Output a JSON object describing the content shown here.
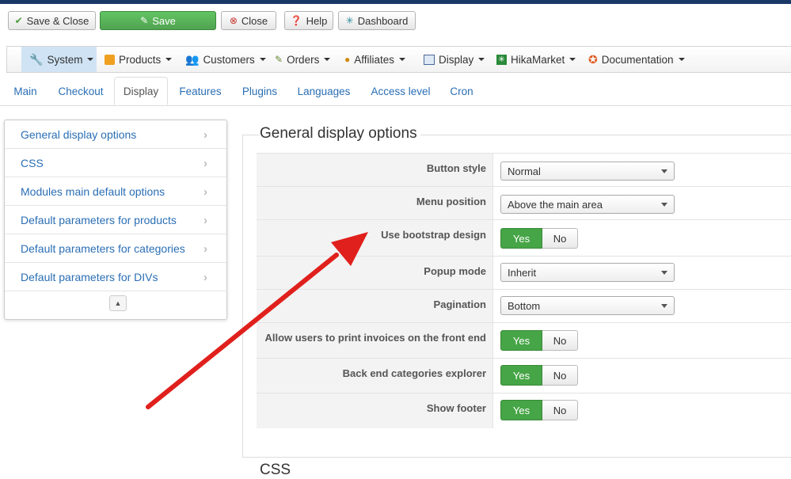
{
  "toolbar": {
    "save_close": "Save & Close",
    "save": "Save",
    "close": "Close",
    "help": "Help",
    "dashboard": "Dashboard"
  },
  "menu": [
    {
      "label": "System",
      "icon": "wrench-icon"
    },
    {
      "label": "Products",
      "icon": "box-icon"
    },
    {
      "label": "Customers",
      "icon": "users-icon"
    },
    {
      "label": "Orders",
      "icon": "orders-icon"
    },
    {
      "label": "Affiliates",
      "icon": "affiliates-icon"
    },
    {
      "label": "Display",
      "icon": "display-icon"
    },
    {
      "label": "HikaMarket",
      "icon": "hikamarket-icon"
    },
    {
      "label": "Documentation",
      "icon": "lifebuoy-icon"
    }
  ],
  "tabs": [
    "Main",
    "Checkout",
    "Display",
    "Features",
    "Plugins",
    "Languages",
    "Access level",
    "Cron"
  ],
  "active_tab": "Display",
  "sidebar": {
    "items": [
      "General display options",
      "CSS",
      "Modules main default options",
      "Default parameters for products",
      "Default parameters for categories",
      "Default parameters for DIVs"
    ]
  },
  "section": {
    "title": "General display options",
    "next_title": "CSS",
    "options": [
      {
        "label": "Button style",
        "type": "select",
        "value": "Normal"
      },
      {
        "label": "Menu position",
        "type": "select",
        "value": "Above the main area"
      },
      {
        "label": "Use bootstrap design",
        "type": "toggle",
        "value": "Yes"
      },
      {
        "label": "Popup mode",
        "type": "select",
        "value": "Inherit"
      },
      {
        "label": "Pagination",
        "type": "select",
        "value": "Bottom"
      },
      {
        "label": "Allow users to print invoices on the front end",
        "type": "toggle",
        "value": "Yes"
      },
      {
        "label": "Back end categories explorer",
        "type": "toggle",
        "value": "Yes"
      },
      {
        "label": "Show footer",
        "type": "toggle",
        "value": "Yes"
      }
    ],
    "yes_label": "Yes",
    "no_label": "No"
  },
  "colors": {
    "accent_green": "#46a546",
    "link_blue": "#2a6eb4",
    "arrow_red": "#e0201c",
    "header_navy": "#1a3867"
  }
}
